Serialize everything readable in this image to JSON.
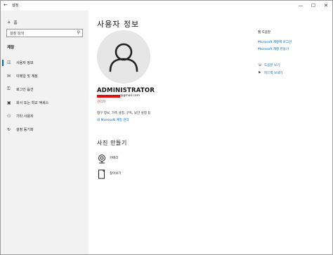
{
  "window": {
    "title": "설정",
    "back": "←",
    "minimize": "—",
    "maximize": "☐",
    "close": "✕"
  },
  "sidebar": {
    "home": "홈",
    "search_placeholder": "설정 검색",
    "section": "계정",
    "items": [
      {
        "label": "사용자 정보",
        "icon": "person-card-icon",
        "glyph": "☷",
        "selected": true
      },
      {
        "label": "이메일 및 계정",
        "icon": "mail-icon",
        "glyph": "✉",
        "selected": false
      },
      {
        "label": "로그인 옵션",
        "icon": "key-icon",
        "glyph": "⚿",
        "selected": false
      },
      {
        "label": "회사 또는 학교 액세스",
        "icon": "briefcase-icon",
        "glyph": "▣",
        "selected": false
      },
      {
        "label": "기타 사용자",
        "icon": "people-icon",
        "glyph": "⚇",
        "selected": false
      },
      {
        "label": "설정 동기화",
        "icon": "sync-icon",
        "glyph": "↻",
        "selected": false
      }
    ]
  },
  "main": {
    "title": "사용자 정보",
    "username": "ADMINISTRATOR",
    "email": "@gmail.com",
    "role": "관리자",
    "billing": "청구 정보, 가족 설정, 구독, 보안 설정 등",
    "ms_link": "내 Microsoft 계정 관리",
    "create_title": "사진 만들기",
    "create_items": [
      {
        "label": "카메라",
        "icon": "camera-icon"
      },
      {
        "label": "찾아보기",
        "icon": "browse-icon"
      }
    ]
  },
  "right": {
    "web_help_title": "웹 도움말",
    "links": [
      "Microsoft 계정에 로그인",
      "Microsoft 계정 만들기"
    ],
    "actions": [
      {
        "label": "도움말 보기",
        "icon": "help-chat-icon",
        "glyph": "☏"
      },
      {
        "label": "피드백 보내기",
        "icon": "feedback-icon",
        "glyph": "⚑"
      }
    ]
  },
  "colors": {
    "accent": "#0067c0",
    "sidebar_bg": "#f2f2f2",
    "role": "#d13438",
    "redaction": "#e01010"
  }
}
